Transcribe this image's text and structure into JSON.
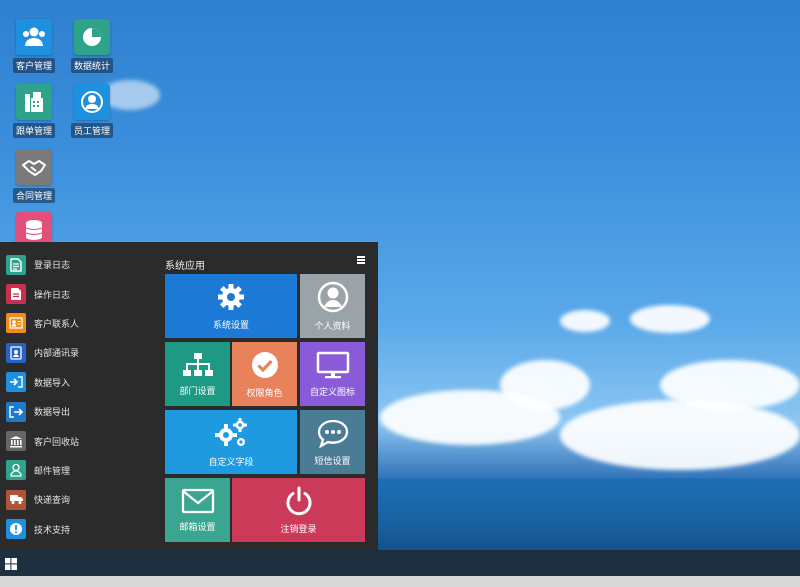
{
  "desktop": {
    "icons": [
      {
        "label": "客户管理",
        "icon": "users-icon",
        "color": "#1e90e0"
      },
      {
        "label": "数据统计",
        "icon": "pie-chart-icon",
        "color": "#2fa38a"
      },
      {
        "label": "跟单管理",
        "icon": "fax-icon",
        "color": "#2fa38a"
      },
      {
        "label": "员工管理",
        "icon": "user-circle-icon",
        "color": "#1e90e0"
      },
      {
        "label": "合同管理",
        "icon": "handshake-icon",
        "color": "#7a7a7a"
      },
      {
        "label": "",
        "icon": "database-icon",
        "color": "#e24f7a"
      }
    ]
  },
  "start_menu": {
    "items": [
      {
        "label": "登录日志",
        "icon": "file-text-icon",
        "color": "#2fa38a"
      },
      {
        "label": "操作日志",
        "icon": "file-icon",
        "color": "#c9304d"
      },
      {
        "label": "客户联系人",
        "icon": "contact-card-icon",
        "color": "#f08c1a"
      },
      {
        "label": "内部通讯录",
        "icon": "address-book-icon",
        "color": "#2563c9"
      },
      {
        "label": "数据导入",
        "icon": "sign-in-icon",
        "color": "#1e90e0"
      },
      {
        "label": "数据导出",
        "icon": "sign-out-icon",
        "color": "#1e7ac9"
      },
      {
        "label": "客户回收站",
        "icon": "bank-icon",
        "color": "#666666"
      },
      {
        "label": "邮件管理",
        "icon": "user-outline-icon",
        "color": "#2fa38a"
      },
      {
        "label": "快递查询",
        "icon": "truck-icon",
        "color": "#b0553a"
      },
      {
        "label": "技术支持",
        "icon": "exclamation-icon",
        "color": "#1e90e0"
      }
    ],
    "apps_title": "系统应用",
    "tiles": {
      "system_settings": {
        "label": "系统设置",
        "color": "#1c7ad6"
      },
      "profile": {
        "label": "个人资料",
        "color": "#9aa3a8"
      },
      "department": {
        "label": "部门设置",
        "color": "#1e9a84"
      },
      "permissions": {
        "label": "权限角色",
        "color": "#e8825a"
      },
      "custom_icons": {
        "label": "自定义图标",
        "color": "#8a5bd8"
      },
      "custom_fields": {
        "label": "自定义字段",
        "color": "#1f9ae0"
      },
      "sms": {
        "label": "短信设置",
        "color": "#4b7c96"
      },
      "mail": {
        "label": "邮箱设置",
        "color": "#3aa590"
      },
      "logout": {
        "label": "注销登录",
        "color": "#cc3a5a"
      }
    }
  }
}
